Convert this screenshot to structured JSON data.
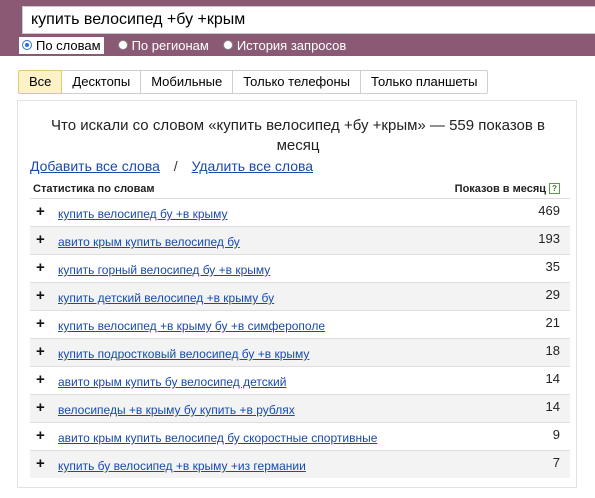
{
  "search": {
    "query": "купить велосипед +бу +крым"
  },
  "radios": [
    {
      "label": "По словам",
      "active": true
    },
    {
      "label": "По регионам",
      "active": false
    },
    {
      "label": "История запросов",
      "active": false
    }
  ],
  "tabs": [
    {
      "label": "Все",
      "active": true
    },
    {
      "label": "Десктопы",
      "active": false
    },
    {
      "label": "Мобильные",
      "active": false
    },
    {
      "label": "Только телефоны",
      "active": false
    },
    {
      "label": "Только планшеты",
      "active": false
    }
  ],
  "panel": {
    "title": "Что искали со словом «купить велосипед +бу +крым» — 559 показов в месяц",
    "add_all": "Добавить все слова",
    "separator": "/",
    "delete_all": "Удалить все слова",
    "col_left": "Статистика по словам",
    "col_right": "Показов в месяц",
    "help_glyph": "?"
  },
  "rows": [
    {
      "phrase": "купить велосипед бу +в крыму",
      "count": "469"
    },
    {
      "phrase": "авито крым купить велосипед бу",
      "count": "193"
    },
    {
      "phrase": "купить горный велосипед бу +в крыму",
      "count": "35"
    },
    {
      "phrase": "купить детский велосипед +в крыму бу",
      "count": "29"
    },
    {
      "phrase": "купить велосипед +в крыму бу +в симферополе",
      "count": "21"
    },
    {
      "phrase": "купить подростковый велосипед бу +в крыму",
      "count": "18"
    },
    {
      "phrase": "авито крым купить бу велосипед детский",
      "count": "14"
    },
    {
      "phrase": "велосипеды +в крыму бу купить +в рублях",
      "count": "14"
    },
    {
      "phrase": "авито крым купить велосипед бу скоростные спортивные",
      "count": "9"
    },
    {
      "phrase": "купить бу велосипед +в крыму +из германии",
      "count": "7"
    }
  ],
  "plus_glyph": "+",
  "colors": {
    "topbar": "#8a5a74",
    "link": "#1a4aa8",
    "active_tab": "#fdf2c7"
  }
}
